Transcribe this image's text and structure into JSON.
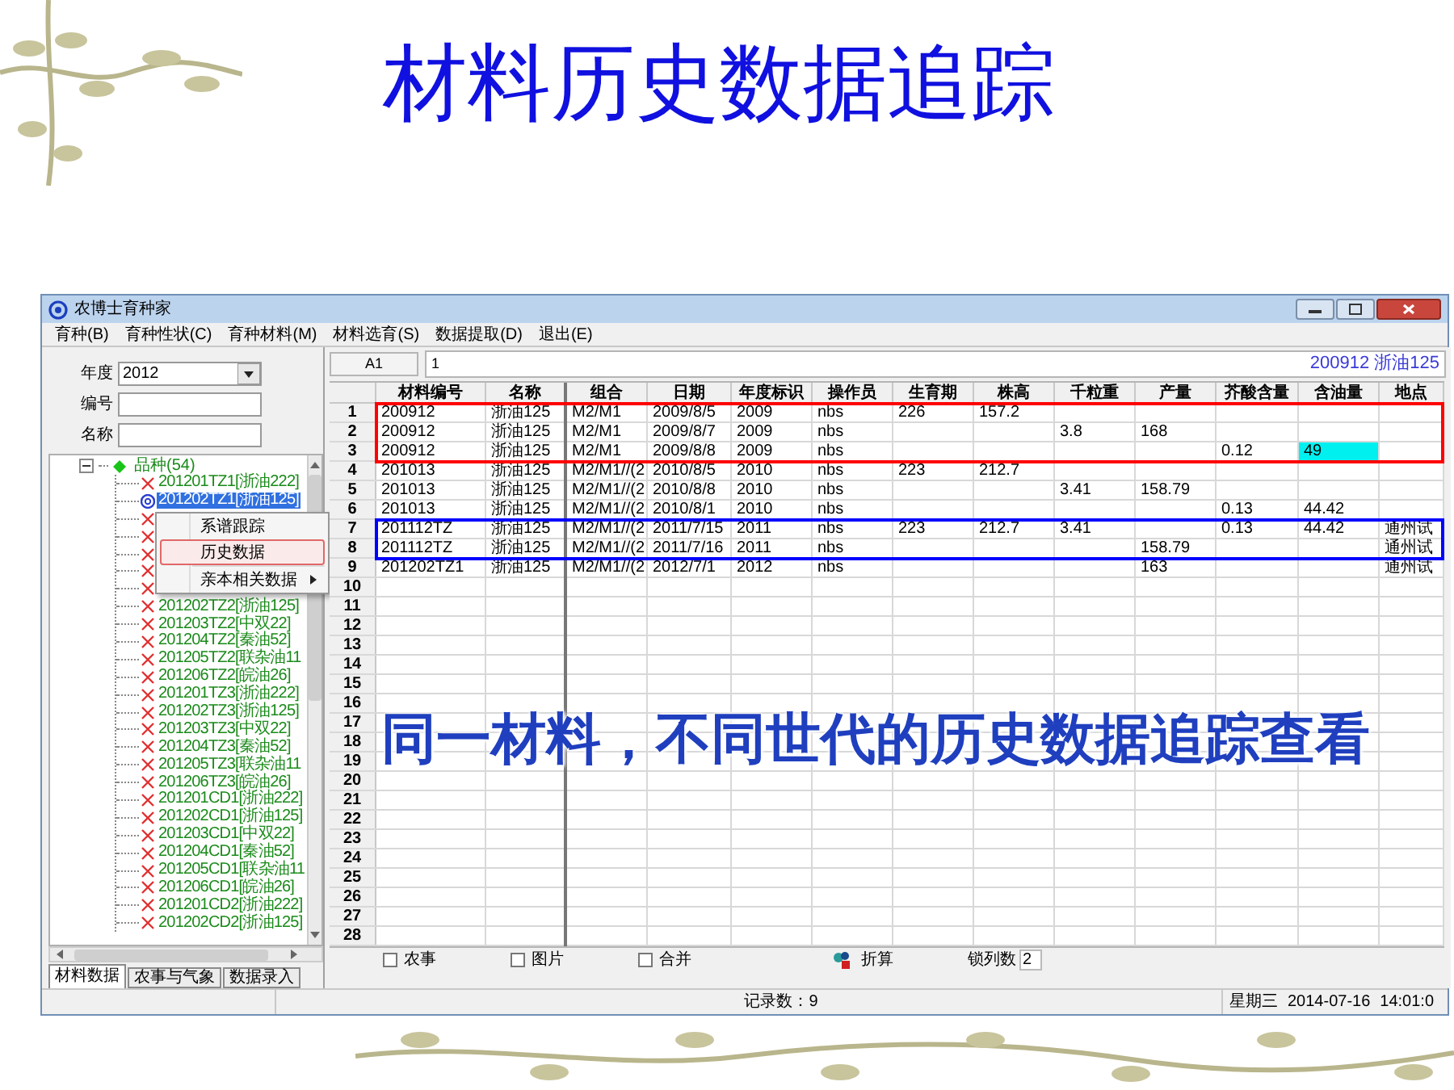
{
  "slide": {
    "title": "材料历史数据追踪",
    "callout": "同一材料，不同世代的历史数据追踪查看"
  },
  "window": {
    "title": "农博士育种家"
  },
  "menu": [
    {
      "label": "育种(B)"
    },
    {
      "label": "育种性状(C)"
    },
    {
      "label": "育种材料(M)"
    },
    {
      "label": "材料选育(S)"
    },
    {
      "label": "数据提取(D)"
    },
    {
      "label": "退出(E)"
    }
  ],
  "filters": [
    {
      "label": "年度",
      "value": "2012",
      "kind": "select"
    },
    {
      "label": "编号",
      "kind": "text"
    },
    {
      "label": "名称",
      "kind": "text"
    }
  ],
  "tree": {
    "label": "品种(54)",
    "expanded": true,
    "children": [
      {
        "label": "201201TZ1[浙油222]",
        "kind": "material",
        "selected": false
      },
      {
        "label": "201202TZ1[浙油125]",
        "kind": "current",
        "selected": true
      },
      {
        "kind": "material"
      },
      {
        "kind": "material"
      },
      {
        "kind": "material"
      },
      {
        "kind": "material"
      },
      {
        "kind": "material"
      },
      {
        "label": "201202TZ2[浙油125]",
        "kind": "material",
        "selected": false
      },
      {
        "label": "201203TZ2[中双22]",
        "kind": "material",
        "selected": false
      },
      {
        "label": "201204TZ2[秦油52]",
        "kind": "material",
        "selected": false
      },
      {
        "label": "201205TZ2[联杂油11",
        "kind": "material",
        "selected": false
      },
      {
        "label": "201206TZ2[皖油26]",
        "kind": "material",
        "selected": false
      },
      {
        "label": "201201TZ3[浙油222]",
        "kind": "material",
        "selected": false
      },
      {
        "label": "201202TZ3[浙油125]",
        "kind": "material",
        "selected": false
      },
      {
        "label": "201203TZ3[中双22]",
        "kind": "material",
        "selected": false
      },
      {
        "label": "201204TZ3[秦油52]",
        "kind": "material",
        "selected": false
      },
      {
        "label": "201205TZ3[联杂油11",
        "kind": "material",
        "selected": false
      },
      {
        "label": "201206TZ3[皖油26]",
        "kind": "material",
        "selected": false
      },
      {
        "label": "201201CD1[浙油222]",
        "kind": "material",
        "selected": false
      },
      {
        "label": "201202CD1[浙油125]",
        "kind": "material",
        "selected": false
      },
      {
        "label": "201203CD1[中双22]",
        "kind": "material",
        "selected": false
      },
      {
        "label": "201204CD1[秦油52]",
        "kind": "material",
        "selected": false
      },
      {
        "label": "201205CD1[联杂油11",
        "kind": "material",
        "selected": false
      },
      {
        "label": "201206CD1[皖油26]",
        "kind": "material",
        "selected": false
      },
      {
        "label": "201201CD2[浙油222]",
        "kind": "material",
        "selected": false
      },
      {
        "label": "201202CD2[浙油125]",
        "kind": "material",
        "selected": false
      }
    ]
  },
  "context_menu": [
    {
      "label": "系谱跟踪",
      "selected": false,
      "submenu": false
    },
    {
      "label": "历史数据",
      "selected": true,
      "submenu": false
    },
    {
      "label": "亲本相关数据",
      "selected": false,
      "submenu": true
    }
  ],
  "left_tabs": [
    {
      "label": "材料数据",
      "selected": true
    },
    {
      "label": "农事与气象",
      "selected": false
    },
    {
      "label": "数据录入",
      "selected": false
    }
  ],
  "cell_ref": "A1",
  "formula": "1",
  "record_label": "200912 浙油125",
  "table": {
    "columns": [
      "材料编号",
      "名称",
      "组合",
      "日期",
      "年度标识",
      "操作员",
      "生育期",
      "株高",
      "千粒重",
      "产量",
      "芥酸含量",
      "含油量",
      "地点"
    ],
    "rows": [
      {
        "number": "1",
        "color": "#ff0000",
        "cells": [
          "200912",
          "浙油125",
          "M2/M1",
          "2009/8/5",
          "2009",
          "nbs",
          "226",
          "157.2",
          null,
          null,
          null,
          null,
          null
        ]
      },
      {
        "number": "2",
        "color": "#ff0000",
        "cells": [
          "200912",
          "浙油125",
          "M2/M1",
          "2009/8/7",
          "2009",
          "nbs",
          null,
          null,
          "3.8",
          "168",
          null,
          null,
          null
        ]
      },
      {
        "number": "3",
        "color": "#ff0000",
        "cells": [
          "200912",
          "浙油125",
          "M2/M1",
          "2009/8/8",
          "2009",
          "nbs",
          null,
          null,
          null,
          null,
          "0.12",
          {
            "text": "49",
            "highlighted": true
          },
          null
        ]
      },
      {
        "number": "4",
        "cells": [
          "201013",
          "浙油125",
          "M2/M1//(2",
          "2010/8/5",
          "2010",
          "nbs",
          "223",
          "212.7",
          null,
          null,
          null,
          null,
          null
        ]
      },
      {
        "number": "5",
        "cells": [
          "201013",
          "浙油125",
          "M2/M1//(2",
          "2010/8/8",
          "2010",
          "nbs",
          null,
          null,
          "3.41",
          "158.79",
          null,
          null,
          null
        ]
      },
      {
        "number": "6",
        "cells": [
          "201013",
          "浙油125",
          "M2/M1//(2",
          "2010/8/1",
          "2010",
          "nbs",
          null,
          null,
          null,
          null,
          "0.13",
          "44.42",
          null
        ]
      },
      {
        "number": "7",
        "color": "#0000ff",
        "cells": [
          "201112TZ",
          "浙油125",
          "M2/M1//(2",
          "2011/7/15",
          "2011",
          "nbs",
          "223",
          "212.7",
          "3.41",
          null,
          "0.13",
          "44.42",
          "通州试"
        ]
      },
      {
        "number": "8",
        "color": "#0000ff",
        "cells": [
          "201112TZ",
          "浙油125",
          "M2/M1//(2",
          "2011/7/16",
          "2011",
          "nbs",
          null,
          null,
          null,
          "158.79",
          null,
          null,
          "通州试"
        ]
      },
      {
        "number": "9",
        "cells": [
          "201202TZ1",
          "浙油125",
          "M2/M1//(2",
          "2012/7/1",
          "2012",
          "nbs",
          null,
          null,
          null,
          "163",
          null,
          null,
          "通州试"
        ]
      },
      {
        "number": "10"
      },
      {
        "number": "11"
      },
      {
        "number": "12"
      },
      {
        "number": "13"
      },
      {
        "number": "14"
      },
      {
        "number": "15"
      },
      {
        "number": "16"
      },
      {
        "number": "17"
      },
      {
        "number": "18"
      },
      {
        "number": "19"
      },
      {
        "number": "20"
      },
      {
        "number": "21"
      },
      {
        "number": "22"
      },
      {
        "number": "23"
      },
      {
        "number": "24"
      },
      {
        "number": "25"
      },
      {
        "number": "26"
      },
      {
        "number": "27"
      },
      {
        "number": "28"
      }
    ]
  },
  "toolbar": {
    "checkboxes": [
      {
        "label": "农事",
        "checked": false
      },
      {
        "label": "图片",
        "checked": false
      },
      {
        "label": "合并",
        "checked": false
      }
    ],
    "convert_button": "折算",
    "lock_columns": {
      "label": "锁列数",
      "value": "2"
    }
  },
  "status_bar": {
    "records": "记录数：9",
    "weekday": "星期三",
    "date": "2014-07-16",
    "time": "14:01:0"
  }
}
